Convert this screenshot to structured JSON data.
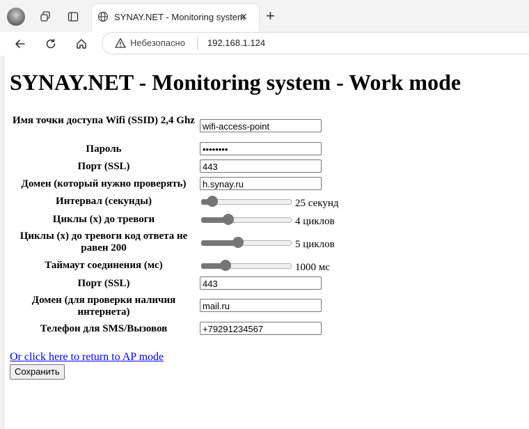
{
  "browser": {
    "tab_title": "SYNAY.NET - Monitoring system",
    "insecure_label": "Небезопасно",
    "url": "192.168.1.124",
    "new_tab_glyph": "+",
    "close_glyph": "×"
  },
  "page": {
    "heading": "SYNAY.NET - Monitoring system - Work mode",
    "fields": [
      {
        "label": "Имя точки доступа Wifi (SSID) 2,4 Ghz",
        "value": "wifi-access-point"
      },
      {
        "label": "Пароль",
        "value": "••••••••"
      },
      {
        "label": "Порт (SSL)",
        "value": "443"
      },
      {
        "label": "Домен (который нужно проверять)",
        "value": "h.synay.ru"
      },
      {
        "label": "Интервал (секунды)",
        "range_text": "25 секунд",
        "level": 0.07
      },
      {
        "label": "Циклы (x) до тревоги",
        "range_text": "4 циклов",
        "level": 0.28
      },
      {
        "label": "Циклы (x) до тревоги код ответа не равен 200",
        "range_text": "5 циклов",
        "level": 0.4
      },
      {
        "label": "Таймаут соединения (мс)",
        "range_text": "1000 мс",
        "level": 0.24
      },
      {
        "label": "Порт (SSL)",
        "value": "443"
      },
      {
        "label": "Домен (для проверки наличия интернета)",
        "value": "mail.ru"
      },
      {
        "label": "Телефон для SMS/Вызовов",
        "value": "+79291234567"
      }
    ],
    "ap_link": "Or click here to return to AP mode",
    "save_button": "Сохранить"
  }
}
